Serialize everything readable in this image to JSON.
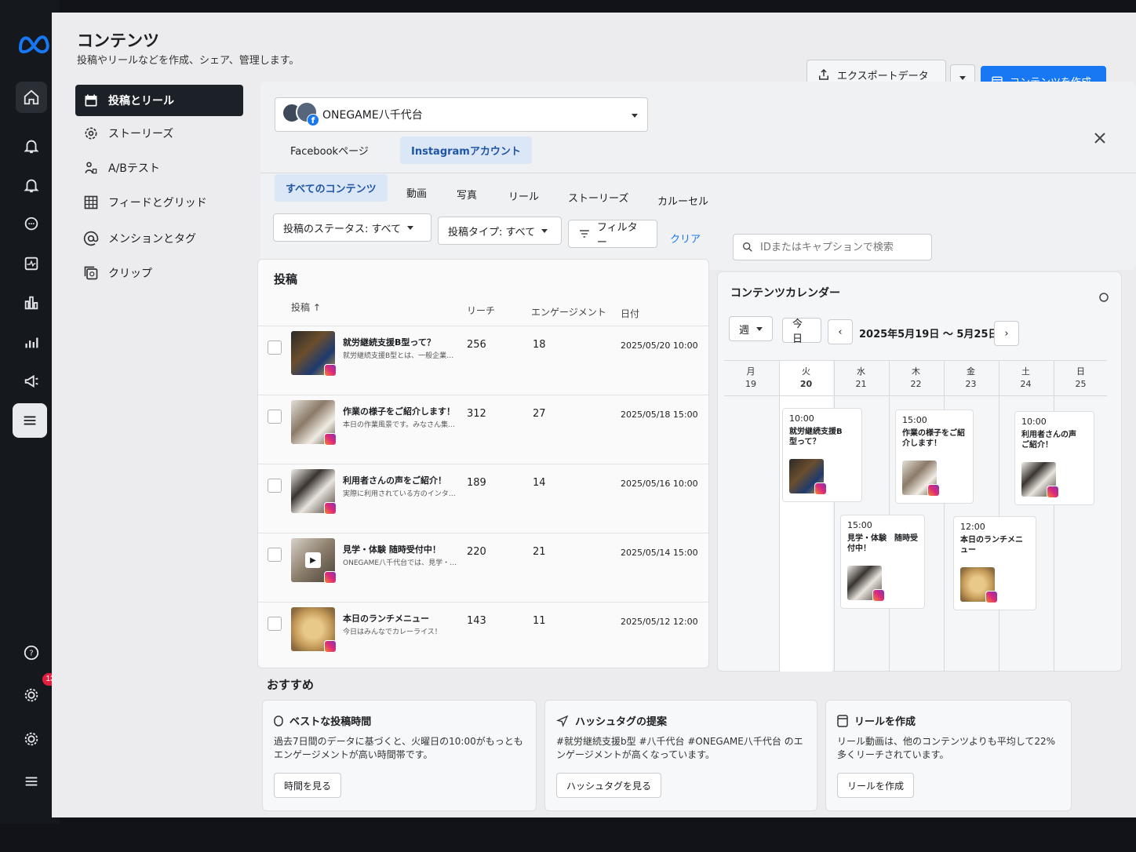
{
  "header": {
    "title": "コンテンツ",
    "subtitle": "投稿やリールなどを作成、シェア、管理します。",
    "export_label": "エクスポートデータ",
    "create_label": "コンテンツを作成"
  },
  "rail": {
    "notification_count": "13"
  },
  "left_nav": {
    "items": [
      {
        "label": "投稿とリール"
      },
      {
        "label": "ストーリーズ"
      },
      {
        "label": "A/Bテスト"
      },
      {
        "label": "フィードとグリッド"
      },
      {
        "label": "メンションとタグ"
      },
      {
        "label": "クリップ"
      }
    ]
  },
  "account": {
    "name": "ONEGAME八千代台"
  },
  "platform_tabs": [
    "Facebookページ",
    "Instagramアカウント"
  ],
  "content_tabs": [
    "すべてのコンテンツ",
    "動画",
    "写真",
    "リール",
    "ストーリーズ",
    "カルーセル"
  ],
  "filters": {
    "status": "投稿のステータス: すべて",
    "type": "投稿タイプ: すべて",
    "filter": "フィルター",
    "clear": "クリア",
    "search_placeholder": "IDまたはキャプションで検索"
  },
  "posts": {
    "heading": "投稿",
    "columns": [
      "投稿 ↑",
      "リーチ",
      "エンゲージメント",
      "日付"
    ],
    "rows": [
      {
        "title": "就労継続支援B型って？",
        "desc": "就労継続支援B型とは、一般企業で…",
        "reach": "256",
        "engagement": "18",
        "date": "2025/05/20 10:00"
      },
      {
        "title": "作業の様子をご紹介します！",
        "desc": "本日の作業風景です。みなさん集中…",
        "reach": "312",
        "engagement": "27",
        "date": "2025/05/18 15:00"
      },
      {
        "title": "利用者さんの声をご紹介！",
        "desc": "実際に利用されている方のインタビ…",
        "reach": "189",
        "engagement": "14",
        "date": "2025/05/16 10:00"
      },
      {
        "title": "見学・体験 随時受付中！",
        "desc": "ONEGAME八千代台では、見学・体…",
        "reach": "220",
        "engagement": "21",
        "date": "2025/05/14 15:00"
      },
      {
        "title": "本日のランチメニュー",
        "desc": "今日はみんなでカレーライス！",
        "reach": "143",
        "engagement": "11",
        "date": "2025/05/12 12:00"
      }
    ]
  },
  "calendar": {
    "heading": "コンテンツカレンダー",
    "view": "週",
    "today": "今日",
    "range": "2025年5月19日 〜 5月25日",
    "days": [
      {
        "dow": "月",
        "date": "19"
      },
      {
        "dow": "火",
        "date": "20"
      },
      {
        "dow": "水",
        "date": "21"
      },
      {
        "dow": "木",
        "date": "22"
      },
      {
        "dow": "金",
        "date": "23"
      },
      {
        "dow": "土",
        "date": "24"
      },
      {
        "dow": "日",
        "date": "25"
      }
    ],
    "events": [
      {
        "time": "10:00",
        "title": "就労継続支援B　型って？"
      },
      {
        "time": "15:00",
        "title": "作業の様子をご紹介します！"
      },
      {
        "time": "10:00",
        "title": "利用者さんの声　ご紹介！"
      },
      {
        "time": "15:00",
        "title": "見学・体験　随時受付中！"
      },
      {
        "time": "12:00",
        "title": "本日のランチメニュー"
      }
    ]
  },
  "recommend": {
    "heading": "おすすめ",
    "cards": [
      {
        "title": "ベストな投稿時間",
        "text": "過去7日間のデータに基づくと、火曜日の10:00がもっともエンゲージメントが高い時間帯です。",
        "button": "時間を見る"
      },
      {
        "title": "ハッシュタグの提案",
        "text": "#就労継続支援b型 #八千代台 #ONEGAME八千代台 のエンゲージメントが高くなっています。",
        "button": "ハッシュタグを見る"
      },
      {
        "title": "リールを作成",
        "text": "リール動画は、他のコンテンツよりも平均して22%多くリーチされています。",
        "button": "リールを作成"
      }
    ]
  }
}
